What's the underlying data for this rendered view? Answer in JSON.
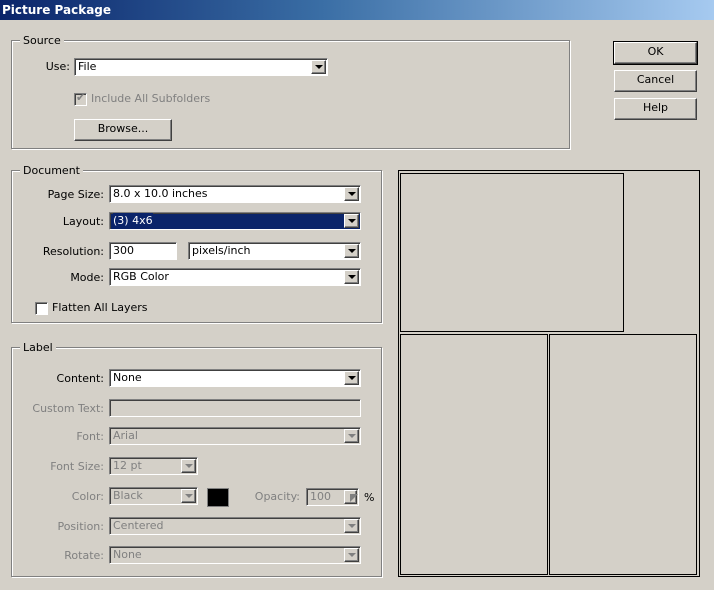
{
  "window": {
    "title": "Picture Package"
  },
  "buttons": {
    "ok": "OK",
    "cancel": "Cancel",
    "help": "Help"
  },
  "source": {
    "legend": "Source",
    "use_label": "Use:",
    "use_value": "File",
    "include_subfolders_label": "Include All Subfolders",
    "include_subfolders_checked": true,
    "browse_label": "Browse..."
  },
  "document": {
    "legend": "Document",
    "page_size_label": "Page Size:",
    "page_size_value": "8.0 x 10.0 inches",
    "layout_label": "Layout:",
    "layout_value": "(3) 4x6",
    "resolution_label": "Resolution:",
    "resolution_value": "300",
    "resolution_unit": "pixels/inch",
    "mode_label": "Mode:",
    "mode_value": "RGB Color",
    "flatten_label": "Flatten All Layers",
    "flatten_checked": false
  },
  "label": {
    "legend": "Label",
    "content_label": "Content:",
    "content_value": "None",
    "custom_text_label": "Custom Text:",
    "custom_text_value": "",
    "font_label": "Font:",
    "font_value": "Arial",
    "font_size_label": "Font Size:",
    "font_size_value": "12 pt",
    "color_label": "Color:",
    "color_value": "Black",
    "color_swatch": "#000000",
    "opacity_label": "Opacity:",
    "opacity_value": "100",
    "opacity_unit": "%",
    "position_label": "Position:",
    "position_value": "Centered",
    "rotate_label": "Rotate:",
    "rotate_value": "None"
  }
}
